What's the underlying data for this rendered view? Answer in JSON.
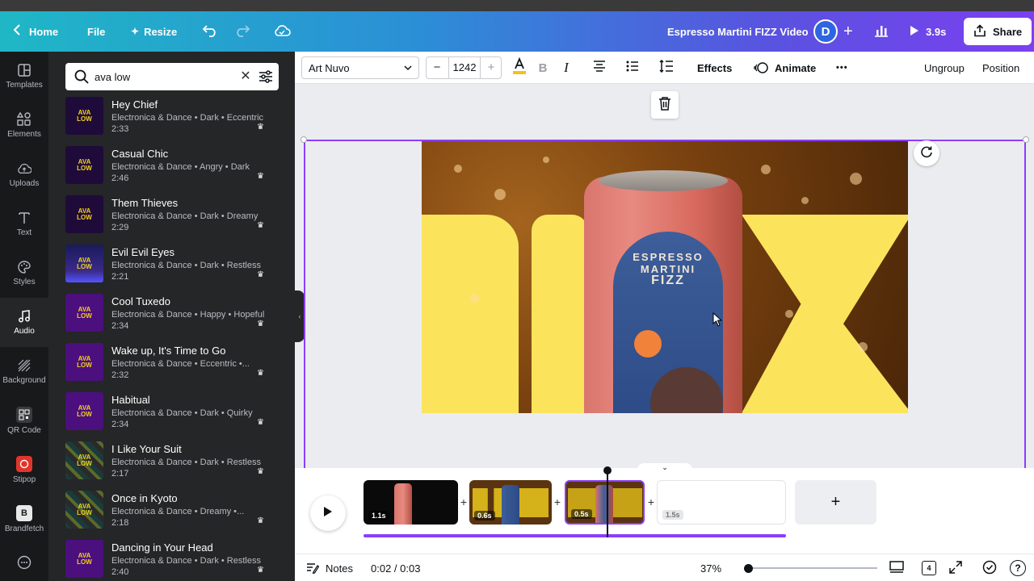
{
  "topbar": {
    "home_label": "Home",
    "file_label": "File",
    "resize_label": "Resize",
    "project_title": "Espresso Martini FIZZ Video",
    "avatar_letter": "D",
    "play_duration": "3.9s",
    "share_label": "Share"
  },
  "rail": {
    "items": [
      {
        "label": "Templates",
        "icon": "templates-icon"
      },
      {
        "label": "Elements",
        "icon": "elements-icon"
      },
      {
        "label": "Uploads",
        "icon": "uploads-icon"
      },
      {
        "label": "Text",
        "icon": "text-icon"
      },
      {
        "label": "Styles",
        "icon": "styles-icon"
      },
      {
        "label": "Audio",
        "icon": "audio-icon"
      },
      {
        "label": "Background",
        "icon": "background-icon"
      },
      {
        "label": "QR Code",
        "icon": "qr-code-icon"
      },
      {
        "label": "Stipop",
        "icon": "stipop-icon"
      },
      {
        "label": "Brandfetch",
        "icon": "brandfetch-icon"
      }
    ]
  },
  "search": {
    "value": "ava low"
  },
  "thumb_logo": {
    "line1": "AVA",
    "line2": "LOW"
  },
  "tracks": [
    {
      "title": "Hey Chief",
      "meta": "Electronica & Dance • Dark • Eccentric",
      "duration": "2:33"
    },
    {
      "title": "Casual Chic",
      "meta": "Electronica & Dance • Angry • Dark",
      "duration": "2:46"
    },
    {
      "title": "Them Thieves",
      "meta": "Electronica & Dance • Dark • Dreamy",
      "duration": "2:29"
    },
    {
      "title": "Evil Evil Eyes",
      "meta": "Electronica & Dance • Dark • Restless",
      "duration": "2:21"
    },
    {
      "title": "Cool Tuxedo",
      "meta": "Electronica & Dance • Happy • Hopeful",
      "duration": "2:34"
    },
    {
      "title": "Wake up, It's Time to Go",
      "meta": "Electronica & Dance • Eccentric •...",
      "duration": "2:32"
    },
    {
      "title": "Habitual",
      "meta": "Electronica & Dance • Dark • Quirky",
      "duration": "2:34"
    },
    {
      "title": "I Like Your Suit",
      "meta": "Electronica & Dance • Dark • Restless",
      "duration": "2:17"
    },
    {
      "title": "Once in Kyoto",
      "meta": "Electronica & Dance • Dreamy •...",
      "duration": "2:18"
    },
    {
      "title": "Dancing in Your Head",
      "meta": "Electronica & Dance • Dark • Restless",
      "duration": "2:40"
    }
  ],
  "toolbar": {
    "font_name": "Art Nuvo",
    "font_size": "1242",
    "minus": "−",
    "plus": "+",
    "effects_label": "Effects",
    "animate_label": "Animate",
    "more_label": "•••",
    "ungroup_label": "Ungroup",
    "position_label": "Position"
  },
  "artwork": {
    "can_line1": "ESPRESSO MARTINI",
    "can_line2": "FIZZ"
  },
  "timeline": {
    "clips": [
      {
        "duration": "1.1s"
      },
      {
        "duration": "0.6s"
      },
      {
        "duration": "0.5s"
      },
      {
        "duration": "1.5s"
      }
    ],
    "add_symbol": "+"
  },
  "footer": {
    "notes_label": "Notes",
    "time": "0:02 / 0:03",
    "zoom": "37%",
    "page_count": "4"
  },
  "colors": {
    "accent": "#8b3dff",
    "panel_bg": "#252627",
    "rail_bg": "#18191b"
  }
}
